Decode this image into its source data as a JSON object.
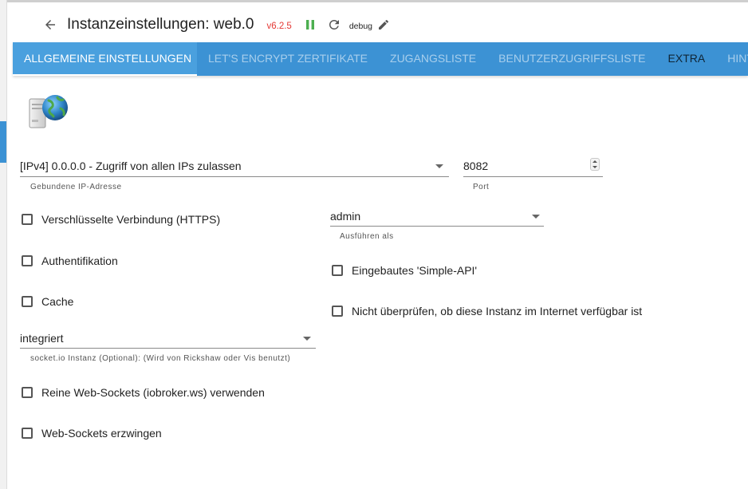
{
  "header": {
    "title": "Instanzeinstellungen: web.0",
    "version": "v6.2.5",
    "log_level": "debug",
    "icons": {
      "back": "arrow-left-icon",
      "pause": "pause-icon",
      "reload": "reload-icon",
      "edit": "pencil-icon"
    }
  },
  "tabs": [
    {
      "label": "ALLGEMEINE EINSTELLUNGEN",
      "active": true
    },
    {
      "label": "LET'S ENCRYPT ZERTIFIKATE"
    },
    {
      "label": "ZUGANGSLISTE"
    },
    {
      "label": "BENUTZERZUGRIFFSLISTE"
    },
    {
      "label": "EXTRA"
    },
    {
      "label": "HINTER"
    }
  ],
  "form": {
    "bind": {
      "value": "[IPv4] 0.0.0.0 - Zugriff von allen IPs zulassen",
      "helper": "Gebundene IP-Adresse"
    },
    "port": {
      "value": "8082",
      "helper": "Port"
    },
    "https": {
      "label": "Verschlüsselte Verbindung (HTTPS)",
      "checked": false
    },
    "run_as": {
      "value": "admin",
      "helper": "Ausführen als"
    },
    "auth": {
      "label": "Authentifikation",
      "checked": false
    },
    "simple_api": {
      "label": "Eingebautes 'Simple-API'",
      "checked": false
    },
    "cache": {
      "label": "Cache",
      "checked": false
    },
    "no_internet_check": {
      "label": "Nicht überprüfen, ob diese Instanz im Internet verfügbar ist",
      "checked": false
    },
    "socketio": {
      "value": "integriert",
      "helper": "socket.io Instanz (Optional): (Wird von Rickshaw oder Vis benutzt)"
    },
    "pure_ws": {
      "label": "Reine Web-Sockets (iobroker.ws) verwenden",
      "checked": false
    },
    "force_ws": {
      "label": "Web-Sockets erzwingen",
      "checked": false
    }
  },
  "colors": {
    "tab_bar": "#3c92d4",
    "active_tab": "#4aa0de",
    "version": "#e53935",
    "pause": "#4caf50"
  }
}
